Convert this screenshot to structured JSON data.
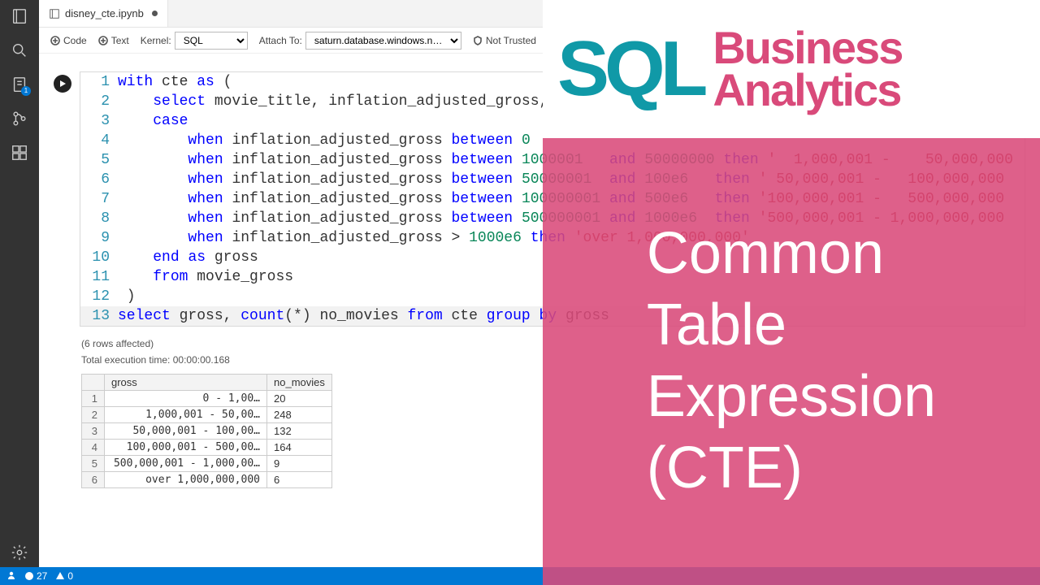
{
  "tab": {
    "filename": "disney_cte.ipynb",
    "modified": true
  },
  "toolbar": {
    "code_label": "Code",
    "text_label": "Text",
    "kernel_label": "Kernel:",
    "kernel_value": "SQL",
    "attach_label": "Attach To:",
    "attach_value": "saturn.database.windows.n…",
    "trust_label": "Not Trusted",
    "run_label": "Run"
  },
  "code": {
    "lines": [
      {
        "n": 1,
        "tokens": [
          [
            "kw",
            "with"
          ],
          [
            "",
            " cte "
          ],
          [
            "kw",
            "as"
          ],
          [
            "",
            " ("
          ]
        ]
      },
      {
        "n": 2,
        "tokens": [
          [
            "",
            "    "
          ],
          [
            "kw",
            "select"
          ],
          [
            "",
            " movie_title, inflation_adjusted_gross,"
          ]
        ]
      },
      {
        "n": 3,
        "tokens": [
          [
            "",
            "    "
          ],
          [
            "kw",
            "case"
          ]
        ]
      },
      {
        "n": 4,
        "tokens": [
          [
            "",
            "        "
          ],
          [
            "kw",
            "when"
          ],
          [
            "",
            " inflation_adjusted_gross "
          ],
          [
            "kw",
            "between"
          ],
          [
            "",
            " "
          ],
          [
            "num",
            "0"
          ]
        ]
      },
      {
        "n": 5,
        "tokens": [
          [
            "",
            "        "
          ],
          [
            "kw",
            "when"
          ],
          [
            "",
            " inflation_adjusted_gross "
          ],
          [
            "kw",
            "between"
          ],
          [
            "",
            " "
          ],
          [
            "num",
            "1000001"
          ],
          [
            "",
            "   "
          ],
          [
            "kw",
            "and"
          ],
          [
            "",
            " "
          ],
          [
            "num",
            "50000000"
          ],
          [
            "",
            " "
          ],
          [
            "kw",
            "then"
          ],
          [
            "",
            " "
          ],
          [
            "str",
            "'  1,000,001 -    50,000,000"
          ]
        ]
      },
      {
        "n": 6,
        "tokens": [
          [
            "",
            "        "
          ],
          [
            "kw",
            "when"
          ],
          [
            "",
            " inflation_adjusted_gross "
          ],
          [
            "kw",
            "between"
          ],
          [
            "",
            " "
          ],
          [
            "num",
            "50000001"
          ],
          [
            "",
            "  "
          ],
          [
            "kw",
            "and"
          ],
          [
            "",
            " "
          ],
          [
            "num",
            "100e6"
          ],
          [
            "",
            "   "
          ],
          [
            "kw",
            "then"
          ],
          [
            "",
            " "
          ],
          [
            "str",
            "' 50,000,001 -   100,000,000"
          ]
        ]
      },
      {
        "n": 7,
        "tokens": [
          [
            "",
            "        "
          ],
          [
            "kw",
            "when"
          ],
          [
            "",
            " inflation_adjusted_gross "
          ],
          [
            "kw",
            "between"
          ],
          [
            "",
            " "
          ],
          [
            "num",
            "100000001"
          ],
          [
            "",
            " "
          ],
          [
            "kw",
            "and"
          ],
          [
            "",
            " "
          ],
          [
            "num",
            "500e6"
          ],
          [
            "",
            "   "
          ],
          [
            "kw",
            "then"
          ],
          [
            "",
            " "
          ],
          [
            "str",
            "'100,000,001 -   500,000,000"
          ]
        ]
      },
      {
        "n": 8,
        "tokens": [
          [
            "",
            "        "
          ],
          [
            "kw",
            "when"
          ],
          [
            "",
            " inflation_adjusted_gross "
          ],
          [
            "kw",
            "between"
          ],
          [
            "",
            " "
          ],
          [
            "num",
            "500000001"
          ],
          [
            "",
            " "
          ],
          [
            "kw",
            "and"
          ],
          [
            "",
            " "
          ],
          [
            "num",
            "1000e6"
          ],
          [
            "",
            "  "
          ],
          [
            "kw",
            "then"
          ],
          [
            "",
            " "
          ],
          [
            "str",
            "'500,000,001 - 1,000,000,000"
          ]
        ]
      },
      {
        "n": 9,
        "tokens": [
          [
            "",
            "        "
          ],
          [
            "kw",
            "when"
          ],
          [
            "",
            " inflation_adjusted_gross > "
          ],
          [
            "num",
            "1000e6"
          ],
          [
            "",
            " "
          ],
          [
            "kw",
            "then"
          ],
          [
            "",
            " "
          ],
          [
            "str",
            "'over 1,000,000,000'"
          ]
        ]
      },
      {
        "n": 10,
        "tokens": [
          [
            "",
            "    "
          ],
          [
            "kw",
            "end"
          ],
          [
            "",
            " "
          ],
          [
            "kw",
            "as"
          ],
          [
            "",
            " gross"
          ]
        ]
      },
      {
        "n": 11,
        "tokens": [
          [
            "",
            "    "
          ],
          [
            "kw",
            "from"
          ],
          [
            "",
            " movie_gross"
          ]
        ]
      },
      {
        "n": 12,
        "tokens": [
          [
            "",
            " )"
          ]
        ]
      },
      {
        "n": 13,
        "hl": true,
        "tokens": [
          [
            "kw",
            "select"
          ],
          [
            "",
            " gross, "
          ],
          [
            "kw",
            "count"
          ],
          [
            "",
            "(*) no_movies "
          ],
          [
            "kw",
            "from"
          ],
          [
            "",
            " cte "
          ],
          [
            "kw",
            "group"
          ],
          [
            "",
            " "
          ],
          [
            "kw",
            "by"
          ],
          [
            "",
            " gross"
          ]
        ]
      }
    ]
  },
  "output": {
    "rows_affected": "(6 rows affected)",
    "exec_time": "Total execution time: 00:00:00.168",
    "columns": [
      "gross",
      "no_movies"
    ],
    "rows": [
      {
        "i": 1,
        "gross": "0 -     1,00…",
        "no_movies": "20"
      },
      {
        "i": 2,
        "gross": "1,000,001 -    50,00…",
        "no_movies": "248"
      },
      {
        "i": 3,
        "gross": "50,000,001 -   100,00…",
        "no_movies": "132"
      },
      {
        "i": 4,
        "gross": "100,000,001 -   500,00…",
        "no_movies": "164"
      },
      {
        "i": 5,
        "gross": "500,000,001 - 1,000,00…",
        "no_movies": "9"
      },
      {
        "i": 6,
        "gross": "over 1,000,000,000",
        "no_movies": "6"
      }
    ]
  },
  "status": {
    "errors": "27",
    "warnings": "0"
  },
  "overlay": {
    "sql": "SQL",
    "business": "Business",
    "analytics": "Analytics",
    "title_l1": "Common",
    "title_l2": "Table",
    "title_l3": "Expression",
    "title_l4": "(CTE)"
  },
  "activity_badge": "1"
}
